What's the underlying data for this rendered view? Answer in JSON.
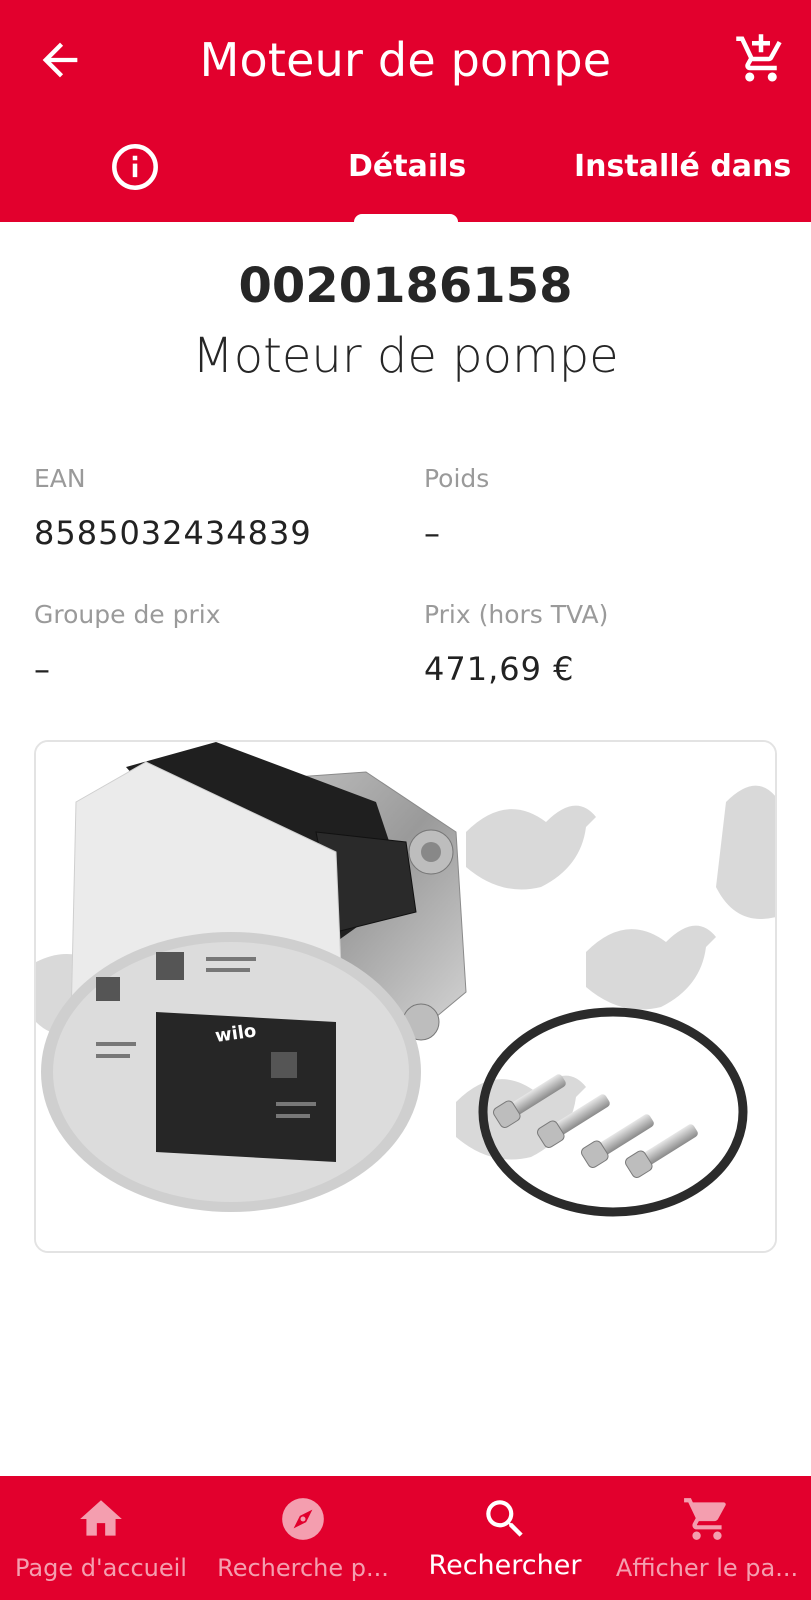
{
  "header": {
    "title": "Moteur de pompe",
    "back_icon": "arrow-back-icon",
    "cart_icon": "add-to-cart-icon",
    "color": "#e2002d"
  },
  "tabs": [
    {
      "icon": "info-icon"
    },
    {
      "label": "Détails",
      "active": true
    },
    {
      "label": "Installé dans"
    }
  ],
  "part": {
    "number": "0020186158",
    "name": "Moteur de pompe"
  },
  "fields": {
    "ean": {
      "label": "EAN",
      "value": "8585032434839"
    },
    "weight": {
      "label": "Poids",
      "value": "–"
    },
    "price_group": {
      "label": "Groupe de prix",
      "value": "–"
    },
    "price": {
      "label": "Prix (hors TVA)",
      "value": "471,69 €"
    }
  },
  "product_image": {
    "brand_mark": "wilo"
  },
  "bottom_nav": {
    "items": [
      {
        "label": "Page d'accueil",
        "icon": "home-icon"
      },
      {
        "label": "Recherche p...",
        "icon": "compass-icon"
      },
      {
        "label": "Rechercher",
        "icon": "search-icon",
        "active": true
      },
      {
        "label": "Afficher le pa...",
        "icon": "cart-icon"
      }
    ]
  }
}
